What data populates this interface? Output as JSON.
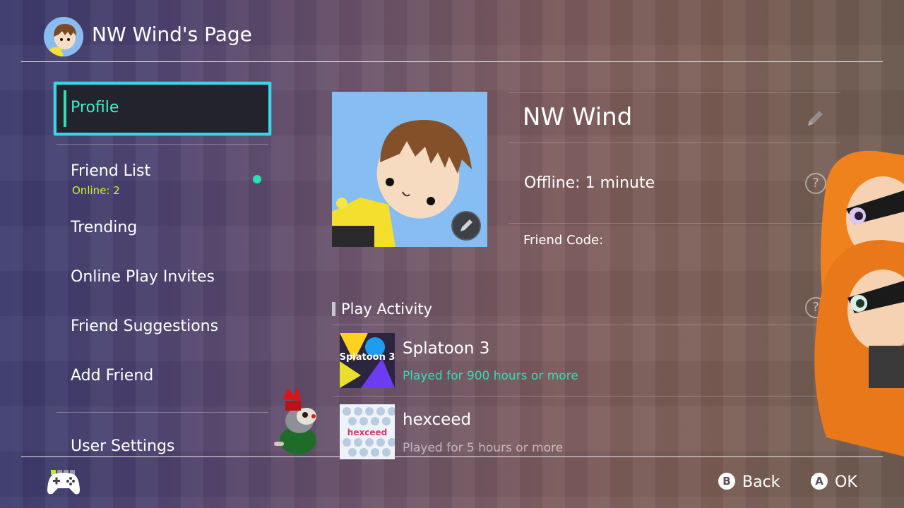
{
  "header": {
    "title": "NW Wind's Page"
  },
  "sidebar": {
    "items": [
      {
        "label": "Profile"
      },
      {
        "label": "Friend List",
        "sub": "Online: 2"
      },
      {
        "label": "Trending"
      },
      {
        "label": "Online Play Invites"
      },
      {
        "label": "Friend Suggestions"
      },
      {
        "label": "Add Friend"
      },
      {
        "label": "User Settings"
      }
    ]
  },
  "profile": {
    "name": "NW Wind",
    "status": "Offline: 1 minute",
    "friend_code_label": "Friend Code:"
  },
  "activity": {
    "title": "Play Activity",
    "games": [
      {
        "title": "Splatoon 3",
        "played": "Played for 900 hours or more"
      },
      {
        "title": "hexceed",
        "played": "Played for 5 hours or more"
      }
    ]
  },
  "footer": {
    "back": {
      "key": "B",
      "label": "Back"
    },
    "ok": {
      "key": "A",
      "label": "OK"
    }
  },
  "colors": {
    "accent_cyan": "#3ed2e6",
    "selected_text": "#3ef0c8",
    "online_green": "#c9f23c",
    "played_highlight": "#2ee0b5"
  }
}
